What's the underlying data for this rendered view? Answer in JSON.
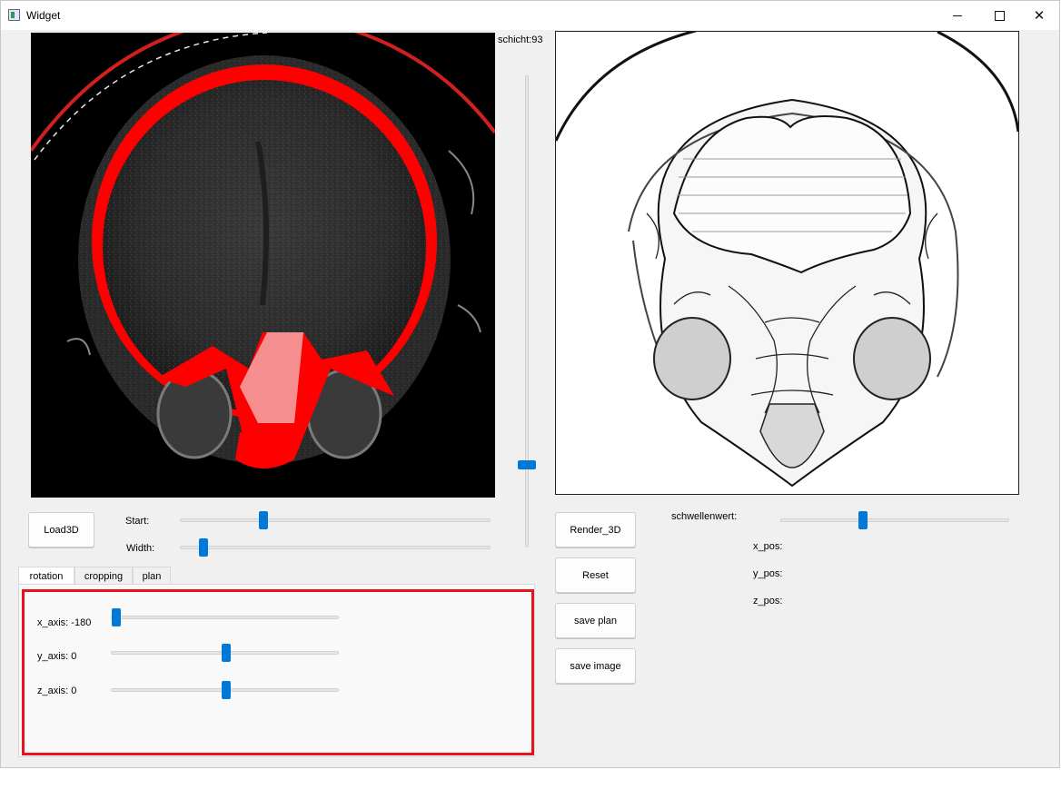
{
  "window": {
    "title": "Widget",
    "icon": "app-window-icon"
  },
  "slice_label": "schicht:93",
  "slice_slider": {
    "value": 0.17
  },
  "buttons": {
    "load3d": "Load3D",
    "render3d": "Render_3D",
    "reset": "Reset",
    "save_plan": "save plan",
    "save_image": "save image"
  },
  "controls": {
    "start": {
      "label": "Start:",
      "value": 0.26
    },
    "width": {
      "label": "Width:",
      "value": 0.06
    },
    "threshold": {
      "label": "schwellenwert:",
      "value": 0.35
    }
  },
  "positions": {
    "x_pos": "x_pos:",
    "y_pos": "y_pos:",
    "z_pos": "z_pos:"
  },
  "tabs": [
    {
      "label": "rotation",
      "active": true
    },
    {
      "label": "cropping",
      "active": false
    },
    {
      "label": "plan",
      "active": false
    }
  ],
  "rotation": {
    "x_axis": {
      "label": "x_axis: -180",
      "value": 0.0
    },
    "y_axis": {
      "label": "y_axis: 0",
      "value": 0.5
    },
    "z_axis": {
      "label": "z_axis: 0",
      "value": 0.5
    }
  },
  "colors": {
    "accent": "#0078d7",
    "highlight": "#e8141b",
    "segmentation": "#ff0000"
  }
}
